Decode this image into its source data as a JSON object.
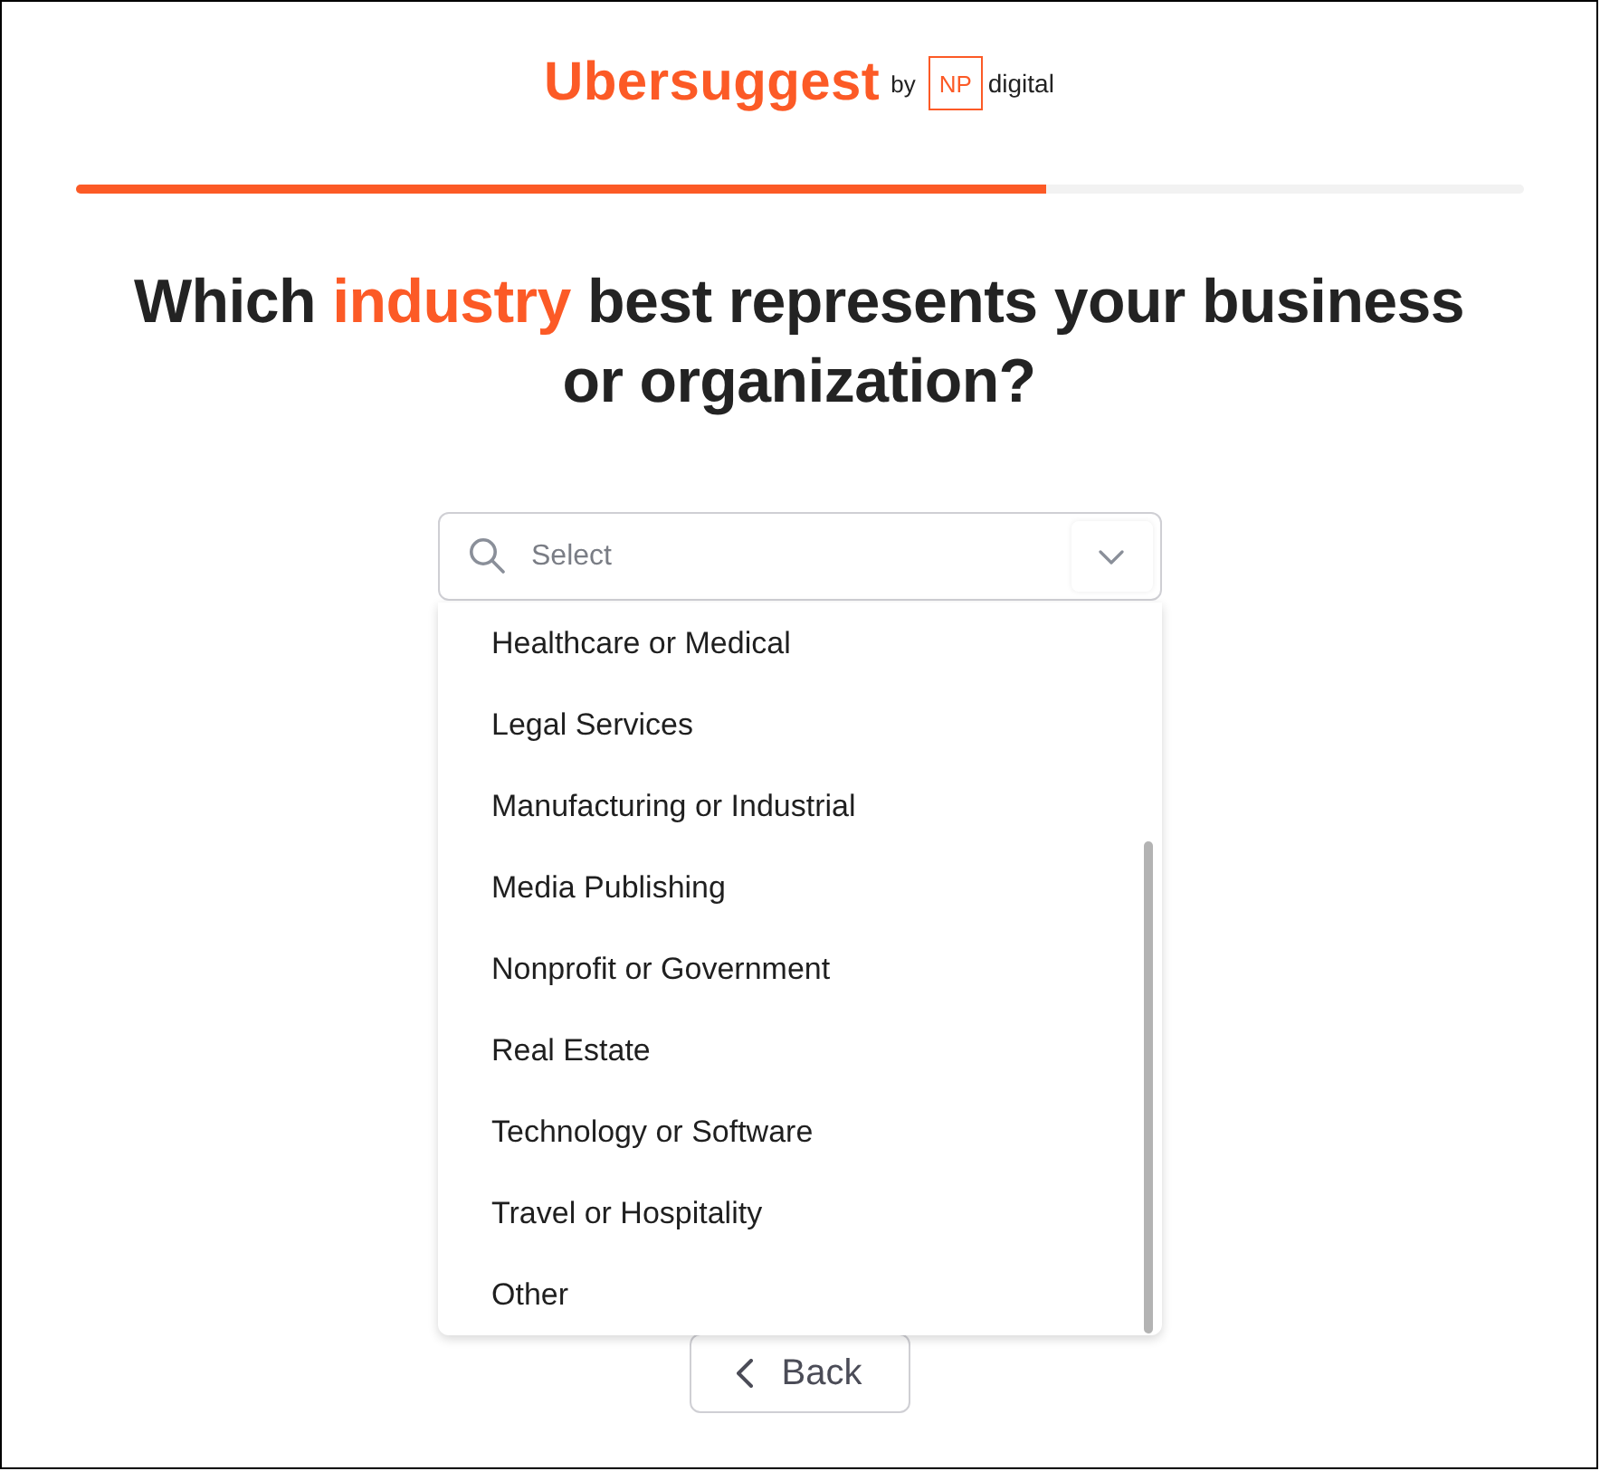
{
  "logo": {
    "name": "Ubersuggest",
    "by": "by",
    "badge": "NP",
    "company": "digital"
  },
  "progress": {
    "level": 0.67
  },
  "question": {
    "before": "Which",
    "highlight": "industry",
    "after": "best represents your business or organization?"
  },
  "select": {
    "placeholder": "Select",
    "expanded": true
  },
  "options": [
    {
      "label": "Healthcare or Medical",
      "selected": false
    },
    {
      "label": "Legal Services",
      "selected": false
    },
    {
      "label": "Manufacturing or Industrial",
      "selected": false
    },
    {
      "label": "Media Publishing",
      "selected": false
    },
    {
      "label": "Nonprofit or Government",
      "selected": false
    },
    {
      "label": "Real Estate",
      "selected": false
    },
    {
      "label": "Technology or Software",
      "selected": false
    },
    {
      "label": "Travel or Hospitality",
      "selected": false
    },
    {
      "label": "Other",
      "selected": false
    }
  ],
  "back_button": {
    "label": "Back"
  }
}
